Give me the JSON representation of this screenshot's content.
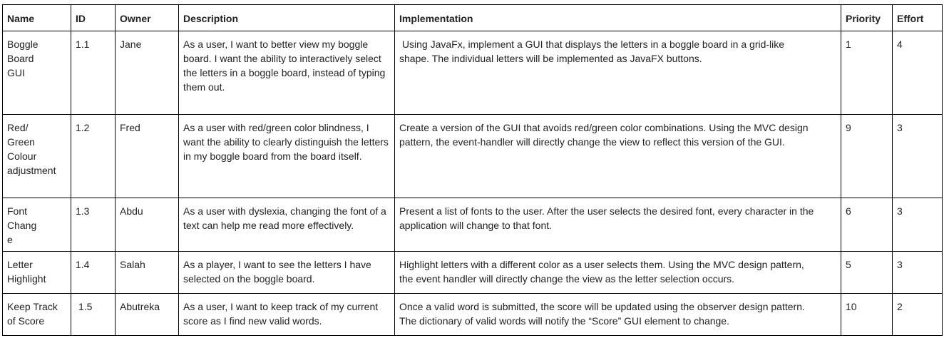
{
  "headers": {
    "name": "Name",
    "id": "ID",
    "owner": "Owner",
    "description": "Description",
    "implementation": "Implementation",
    "priority": "Priority",
    "effort": "Effort"
  },
  "rows": [
    {
      "name": "Boggle Board GUI",
      "id": "1.1",
      "owner": "Jane",
      "description": "As a user, I want to better view my boggle board. I want the ability to interactively select the letters in a boggle board, instead of typing them out.",
      "implementation": " Using JavaFx, implement a GUI that displays the letters in a boggle board in a grid-like shape. The individual letters will be implemented as JavaFX buttons.",
      "priority": "1",
      "effort": "4"
    },
    {
      "name": "Red/ Green Colour adjustment",
      "id": "1.2",
      "owner": "Fred",
      "description": "As a user with red/green color blindness, I want the ability to clearly distinguish the letters in my boggle board from the board itself.",
      "implementation": "Create a version of the GUI that avoids red/green color combinations. Using the MVC design pattern, the event-handler will directly change the view to reflect this version of the GUI.",
      "priority": "9",
      "effort": "3"
    },
    {
      "name": "Font Change",
      "id": "1.3",
      "owner": "Abdu",
      "description": "As a user with dyslexia, changing the font of a text can help me read more effectively.",
      "implementation": "Present a list of fonts to the user. After the user selects the desired font, every character in the application will change to that font.",
      "priority": "6",
      "effort": "3"
    },
    {
      "name": "Letter Highlight",
      "id": "1.4",
      "owner": "Salah",
      "description": "As a player, I want to see the letters I have selected on the boggle board.",
      "implementation": "Highlight letters with a different color as a user selects them. Using the MVC design pattern, the event handler will directly change the view as the letter selection occurs.",
      "priority": "5",
      "effort": "3"
    },
    {
      "name": "Keep Track of Score",
      "id": "1.5",
      "owner": "Abutreka",
      "description": "As a user, I want to keep track of my current score as I find new valid words.",
      "implementation": "Once a valid word is submitted, the score will be updated using the observer design pattern. The dictionary of valid words will notify the “Score” GUI element to change.",
      "priority": "10",
      "effort": "2"
    }
  ]
}
